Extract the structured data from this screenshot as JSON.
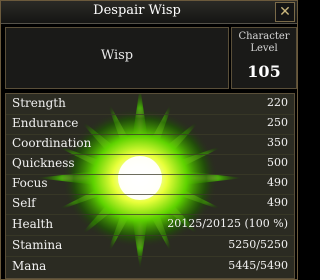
{
  "window": {
    "title": "Despair Wisp"
  },
  "creature": {
    "name": "Wisp"
  },
  "level": {
    "label_line1": "Character",
    "label_line2": "Level",
    "value": "105"
  },
  "stats": [
    {
      "label": "Strength",
      "value": "220"
    },
    {
      "label": "Endurance",
      "value": "250"
    },
    {
      "label": "Coordination",
      "value": "350"
    },
    {
      "label": "Quickness",
      "value": "500"
    },
    {
      "label": "Focus",
      "value": "490"
    },
    {
      "label": "Self",
      "value": "490"
    },
    {
      "label": "Health",
      "value": "20125/20125 (100 %)"
    },
    {
      "label": "Stamina",
      "value": "5250/5250"
    },
    {
      "label": "Mana",
      "value": "5445/5490"
    }
  ],
  "icons": {
    "close": "close-x-icon",
    "portrait": "wisp-glow-portrait"
  },
  "colors": {
    "glow_core": "#ffffff",
    "glow_inner": "#f6ff6a",
    "glow_outer": "#39b000",
    "border": "#6b5a3c"
  }
}
